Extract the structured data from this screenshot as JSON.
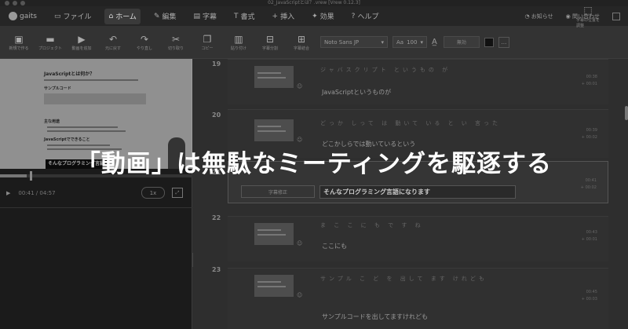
{
  "window": {
    "title": "02_JavaScriptとは？.vrew [Vrew 0.12.3]"
  },
  "tabs": [
    {
      "label": "gaits",
      "icon": "user-icon"
    },
    {
      "label": "ファイル",
      "icon": "file-icon"
    },
    {
      "label": "ホーム",
      "icon": "home-icon"
    },
    {
      "label": "編集",
      "icon": "edit-icon"
    },
    {
      "label": "字幕",
      "icon": "subtitle-icon"
    },
    {
      "label": "書式",
      "icon": "format-icon"
    },
    {
      "label": "挿入",
      "icon": "insert-icon"
    },
    {
      "label": "効果",
      "icon": "effect-icon"
    },
    {
      "label": "ヘルプ",
      "icon": "help-icon"
    }
  ],
  "header_right": {
    "notifications": "お知らせ",
    "contact": "問い合わせ"
  },
  "ribbon": {
    "buttons": [
      {
        "label": "新規で作る",
        "icon": "new-file-icon"
      },
      {
        "label": "プロジェクト",
        "icon": "project-icon"
      },
      {
        "label": "動画を追加",
        "icon": "add-video-icon"
      },
      {
        "label": "元に戻す",
        "icon": "undo-icon"
      },
      {
        "label": "やり直し",
        "icon": "redo-icon"
      },
      {
        "label": "切り取り",
        "icon": "scissors-icon"
      },
      {
        "label": "コピー",
        "icon": "copy-icon"
      },
      {
        "label": "貼り付け",
        "icon": "paste-icon"
      },
      {
        "label": "字幕分割",
        "icon": "split-icon"
      },
      {
        "label": "字幕結合",
        "icon": "merge-icon"
      }
    ],
    "font": "Noto Sans JP",
    "font_size_prefix": "Aa",
    "font_size": "100",
    "color_label": "無効",
    "right_button": "字幕の位置を調整"
  },
  "preview": {
    "doc_title": "JavaScriptとは何か？",
    "section1": "サンプルコード",
    "section2": "主な用途",
    "section3": "JavaScriptでできること",
    "caption": "そんなプログラミング言語"
  },
  "player": {
    "time": "00:41 / 04:57",
    "speed": "1x",
    "progress": 0.14
  },
  "clips": [
    {
      "num": "19",
      "furigana": "ジャバスクリプト というもの が",
      "text": "JavaScriptというものが",
      "t1": "00:38",
      "t2": "+ 00:01"
    },
    {
      "num": "20",
      "furigana": "どっか しって は 動いて いる と い 言った",
      "text": "どこかしらでは動いているという",
      "t1": "00:39",
      "t2": "+ 00:02"
    },
    {
      "num": "21",
      "edit_label": "字幕修正",
      "text": "そんなプログラミング言語になります",
      "t1": "00:41",
      "t2": "+ 00:02"
    },
    {
      "num": "22",
      "furigana": "ま こ こ に も で す ね",
      "text": "ここにも",
      "t1": "00:43",
      "t2": "+ 00:01"
    },
    {
      "num": "23",
      "furigana": "サンプル こ ど を 出して ます けれども",
      "text": "サンプルコードを出してますけれども",
      "t1": "00:45",
      "t2": "+ 00:03"
    }
  ],
  "overlay": {
    "text": "「動画」は無駄なミーティングを駆逐する"
  }
}
